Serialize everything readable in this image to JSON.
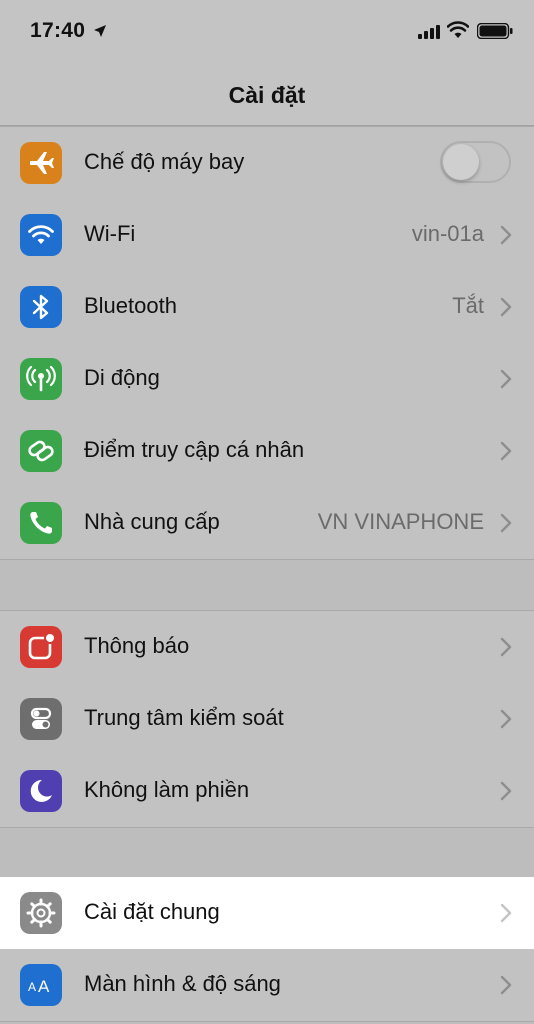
{
  "status_bar": {
    "time": "17:40"
  },
  "nav": {
    "title": "Cài đặt"
  },
  "groups": [
    {
      "items": [
        {
          "label": "Chế độ máy bay",
          "icon": "airplane-icon",
          "icon_color": "#d9821c",
          "control": "toggle",
          "toggle_on": false
        },
        {
          "label": "Wi-Fi",
          "icon": "wifi-icon",
          "icon_color": "#1f6fd0",
          "value": "vin-01a"
        },
        {
          "label": "Bluetooth",
          "icon": "bluetooth-icon",
          "icon_color": "#1f6fd0",
          "value": "Tắt"
        },
        {
          "label": "Di động",
          "icon": "cellular-antenna-icon",
          "icon_color": "#3aa54b"
        },
        {
          "label": "Điểm truy cập cá nhân",
          "icon": "hotspot-link-icon",
          "icon_color": "#3aa54b"
        },
        {
          "label": "Nhà cung cấp",
          "icon": "phone-icon",
          "icon_color": "#3aa54b",
          "value": "VN VINAPHONE"
        }
      ]
    },
    {
      "items": [
        {
          "label": "Thông báo",
          "icon": "notifications-icon",
          "icon_color": "#d63a33"
        },
        {
          "label": "Trung tâm kiểm soát",
          "icon": "control-center-icon",
          "icon_color": "#6e6e6e"
        },
        {
          "label": "Không làm phiền",
          "icon": "moon-icon",
          "icon_color": "#4f3fb0"
        }
      ]
    },
    {
      "items": [
        {
          "label": "Cài đặt chung",
          "icon": "gear-icon",
          "icon_color": "#8a8a8a",
          "highlighted": true
        },
        {
          "label": "Màn hình & độ sáng",
          "icon": "display-text-size-icon",
          "icon_color": "#1f6fd0"
        }
      ]
    }
  ]
}
